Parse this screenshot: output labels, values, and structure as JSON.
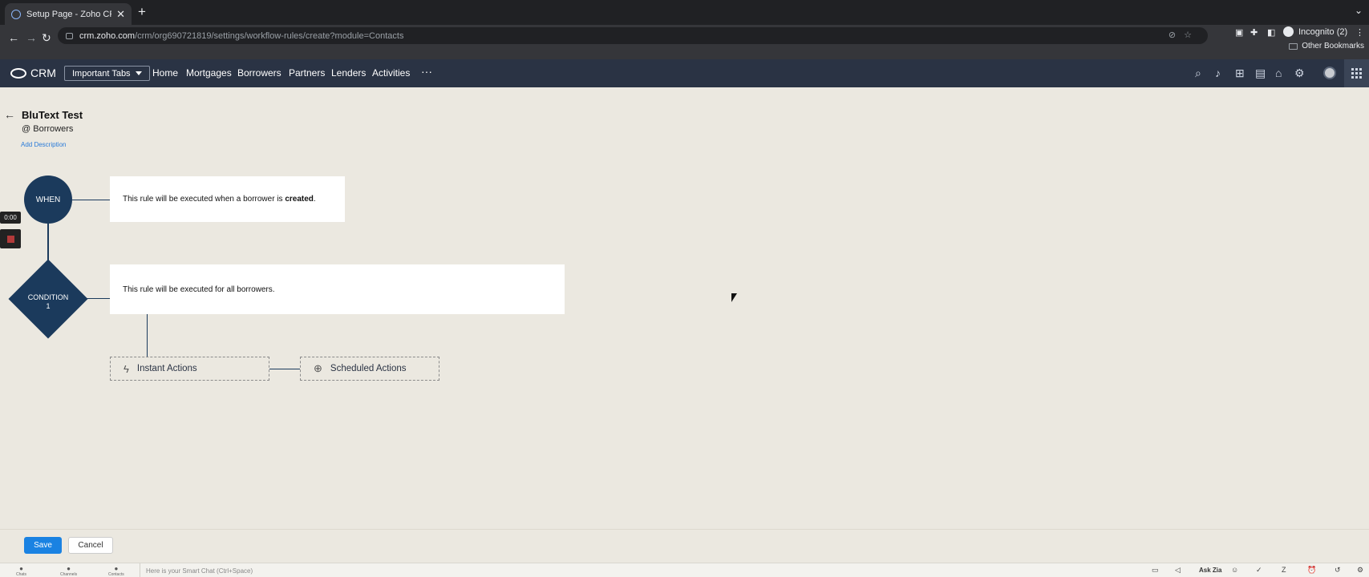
{
  "browser": {
    "tab_title": "Setup Page - Zoho CRM",
    "url_host": "crm.zoho.com",
    "url_path": "/crm/org690721819/settings/workflow-rules/create?module=Contacts",
    "profile_label": "Incognito (2)",
    "bookmarks_label": "Other Bookmarks"
  },
  "crm_header": {
    "app_name": "CRM",
    "tabs_dropdown": "Important Tabs",
    "nav": [
      "Home",
      "Mortgages",
      "Borrowers",
      "Partners",
      "Lenders",
      "Activities"
    ],
    "more": "···"
  },
  "rule": {
    "name": "BluText Test",
    "module_prefix": "@",
    "module": "Borrowers",
    "add_description": "Add Description"
  },
  "flow": {
    "when_label": "WHEN",
    "when_text_prefix": "This rule will be executed when a borrower is ",
    "when_text_emph": "created",
    "when_text_suffix": ".",
    "condition_label": "CONDITION",
    "condition_number": "1",
    "condition_text": "This rule will be executed for all borrowers.",
    "instant_actions": "Instant Actions",
    "scheduled_actions": "Scheduled Actions"
  },
  "recorder": {
    "timer": "0:00"
  },
  "footer": {
    "save": "Save",
    "cancel": "Cancel"
  },
  "chatbar": {
    "items": [
      "Chats",
      "Channels",
      "Contacts"
    ],
    "smart_chat_placeholder": "Here is your Smart Chat (Ctrl+Space)",
    "ask_zia": "Ask Zia"
  },
  "colors": {
    "nav_bg": "#2a3344",
    "flow_node": "#1b3a5c",
    "page_bg": "#ebe8e0",
    "primary_button": "#1a82e2",
    "link": "#2a7bd9"
  }
}
